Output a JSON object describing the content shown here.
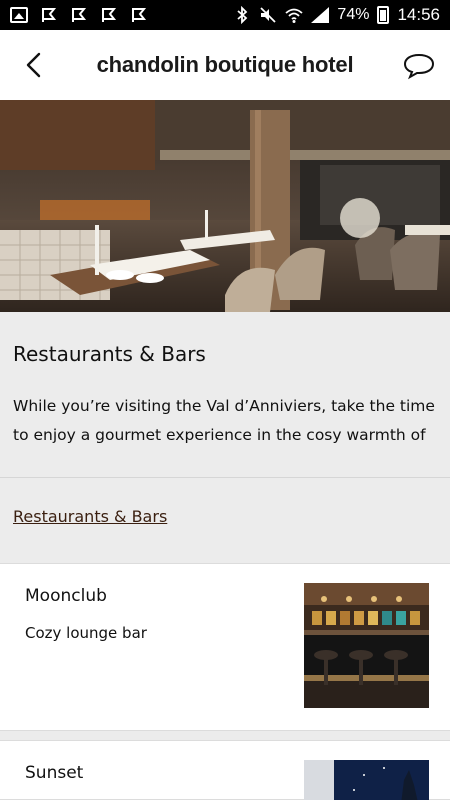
{
  "status_bar": {
    "battery": "74%",
    "time": "14:56"
  },
  "header": {
    "title": "chandolin boutique hotel",
    "back_icon": "back-arrow-icon",
    "chat_icon": "chat-bubble-icon"
  },
  "intro": {
    "title": "Restaurants & Bars",
    "text": "While you’re visiting the Val d’Anniviers, take the time to enjoy a gourmet experience in the cosy warmth of"
  },
  "link": {
    "label": "Restaurants & Bars"
  },
  "items": [
    {
      "title": "Moonclub",
      "subtitle": "Cozy lounge bar"
    },
    {
      "title": "Sunset",
      "subtitle": ""
    }
  ]
}
